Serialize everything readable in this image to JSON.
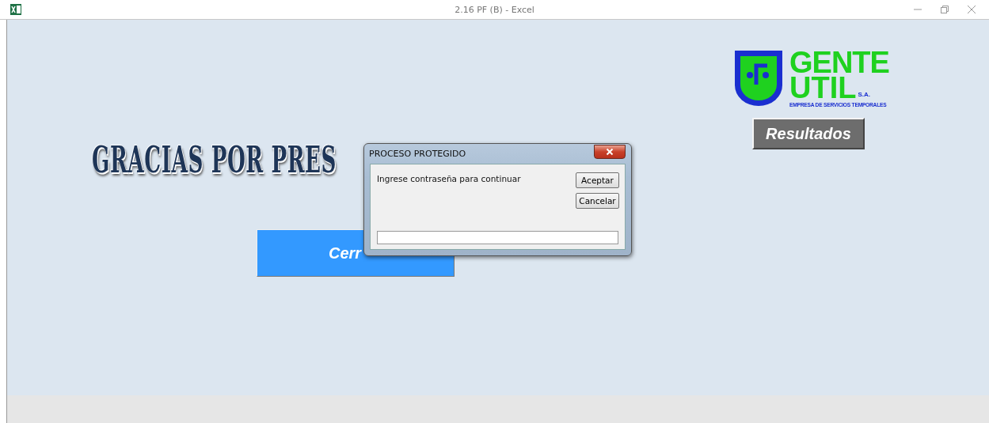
{
  "window": {
    "title": "2.16 PF (B) - Excel"
  },
  "sheet": {
    "heading": "GRACIAS POR PRES",
    "close_button": "Cerr",
    "logo": {
      "line1": "GENTE",
      "line2": "UTIL",
      "suffix": "S.A.",
      "tagline": "EMPRESA DE SERVICIOS TEMPORALES"
    },
    "results_button": "Resultados"
  },
  "dialog": {
    "title": "PROCESO PROTEGIDO",
    "prompt": "Ingrese contraseña para continuar",
    "buttons": [
      "Aceptar",
      "Cancelar"
    ]
  }
}
